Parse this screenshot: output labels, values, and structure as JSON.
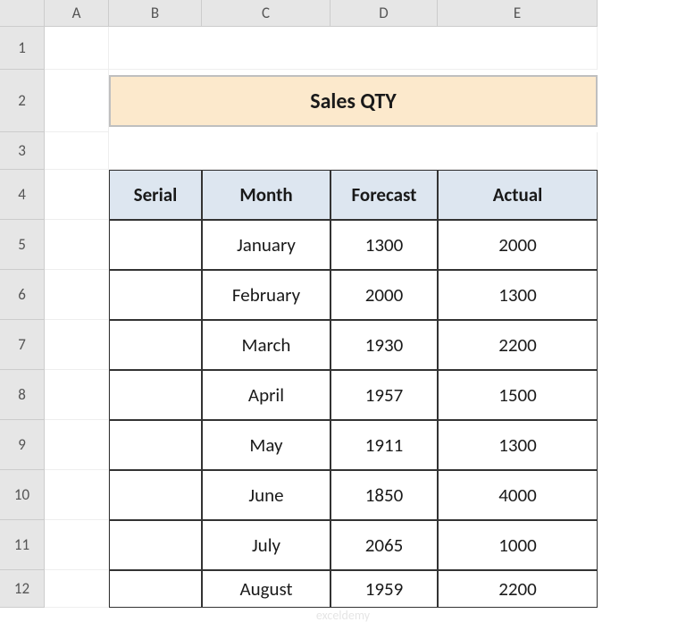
{
  "columns": [
    "A",
    "B",
    "C",
    "D",
    "E"
  ],
  "rows": [
    "1",
    "2",
    "3",
    "4",
    "5",
    "6",
    "7",
    "8",
    "9",
    "10",
    "11",
    "12"
  ],
  "title": "Sales QTY",
  "headers": {
    "serial": "Serial",
    "month": "Month",
    "forecast": "Forecast",
    "actual": "Actual"
  },
  "data": [
    {
      "serial": "",
      "month": "January",
      "forecast": "1300",
      "actual": "2000"
    },
    {
      "serial": "",
      "month": "February",
      "forecast": "2000",
      "actual": "1300"
    },
    {
      "serial": "",
      "month": "March",
      "forecast": "1930",
      "actual": "2200"
    },
    {
      "serial": "",
      "month": "April",
      "forecast": "1957",
      "actual": "1500"
    },
    {
      "serial": "",
      "month": "May",
      "forecast": "1911",
      "actual": "1300"
    },
    {
      "serial": "",
      "month": "June",
      "forecast": "1850",
      "actual": "4000"
    },
    {
      "serial": "",
      "month": "July",
      "forecast": "2065",
      "actual": "1000"
    },
    {
      "serial": "",
      "month": "August",
      "forecast": "1959",
      "actual": "2200"
    }
  ],
  "watermark": "exceldemy",
  "chart_data": {
    "type": "table",
    "title": "Sales QTY",
    "columns": [
      "Serial",
      "Month",
      "Forecast",
      "Actual"
    ],
    "rows": [
      [
        "",
        "January",
        1300,
        2000
      ],
      [
        "",
        "February",
        2000,
        1300
      ],
      [
        "",
        "March",
        1930,
        2200
      ],
      [
        "",
        "April",
        1957,
        1500
      ],
      [
        "",
        "May",
        1911,
        1300
      ],
      [
        "",
        "June",
        1850,
        4000
      ],
      [
        "",
        "July",
        2065,
        1000
      ],
      [
        "",
        "August",
        1959,
        2200
      ]
    ]
  }
}
